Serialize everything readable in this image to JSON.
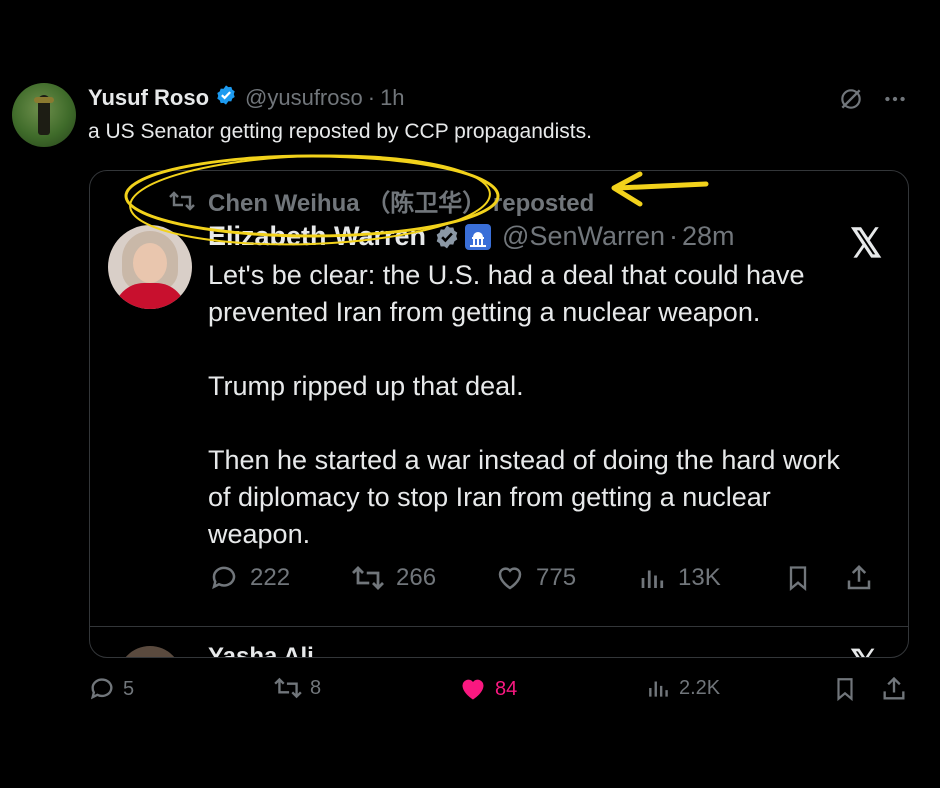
{
  "tweet": {
    "author_name": "Yusuf Roso",
    "handle": "@yusufroso",
    "separator": "·",
    "time": "1h",
    "text": "a US Senator getting reposted by CCP propagandists.",
    "actions": {
      "replies": "5",
      "reposts": "8",
      "likes": "84",
      "views": "2.2K"
    }
  },
  "quoted": {
    "reposter_line": "Chen Weihua （陈卫华） reposted",
    "author_name": "Elizabeth Warren",
    "handle": "@SenWarren",
    "separator": "·",
    "time": "28m",
    "x_logo": "𝕏",
    "paragraphs": [
      "Let's be clear: the U.S. had a deal that could have prevented Iran from getting a nuclear weapon.",
      "Trump ripped up that deal.",
      "Then he started a war instead of doing the hard work of diplomacy to stop Iran from getting a nuclear weapon."
    ],
    "actions": {
      "replies": "222",
      "reposts": "266",
      "likes": "775",
      "views": "13K"
    },
    "next_preview": "Yasha Ali",
    "next_x_logo": "𝕏"
  },
  "colors": {
    "background": "#000000",
    "text": "#e7e9ea",
    "muted": "#71767b",
    "verified": "#1d9bf0",
    "like": "#f91880",
    "annotation": "#f2d21b"
  },
  "icons": [
    "grok-icon",
    "more-icon",
    "repost-icon",
    "reply-icon",
    "like-icon",
    "views-icon",
    "bookmark-icon",
    "share-icon",
    "verified-badge-icon",
    "capitol-icon",
    "x-logo-icon"
  ]
}
